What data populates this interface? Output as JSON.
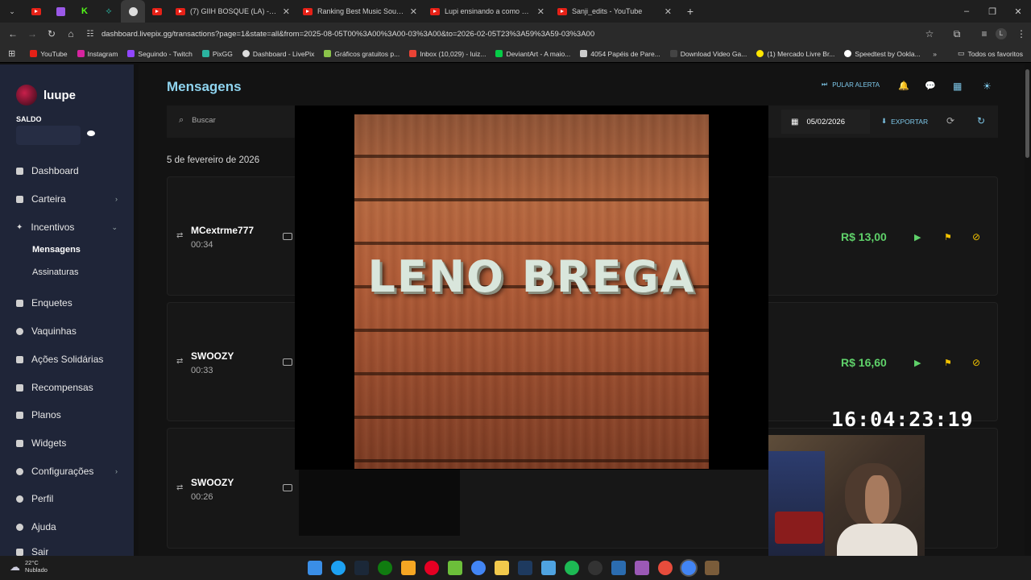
{
  "browser": {
    "tabs": [
      {
        "label": "(7) GIIH BOSQUE (LA) - YouTub",
        "active": false
      },
      {
        "label": "Ranking Best Music Sounds 😊",
        "active": false
      },
      {
        "label": "Lupi ensinando a como ganhar",
        "active": false
      },
      {
        "label": "Sanji_edits - YouTube",
        "active": false
      }
    ],
    "url": "dashboard.livepix.gg/transactions?page=1&state=all&from=2025-08-05T00%3A00%3A00-03%3A00&to=2026-02-05T23%3A59%3A59-03%3A00",
    "bookmarks": [
      {
        "label": "YouTube",
        "color": "#e62117"
      },
      {
        "label": "Instagram",
        "color": "#d6249f"
      },
      {
        "label": "Seguindo - Twitch",
        "color": "#9146ff"
      },
      {
        "label": "PixGG",
        "color": "#2bb3a0"
      },
      {
        "label": "Dashboard - LivePix",
        "color": "#dddddd"
      },
      {
        "label": "Gráficos gratuitos p...",
        "color": "#8bc34a"
      },
      {
        "label": "Inbox (10,029) - luiz...",
        "color": "#ea4335"
      },
      {
        "label": "DeviantArt - A maio...",
        "color": "#05cc47"
      },
      {
        "label": "4054 Papéis de Pare...",
        "color": "#cccccc"
      },
      {
        "label": "Download Video Ga...",
        "color": "#444444"
      },
      {
        "label": "(1) Mercado Livre Br...",
        "color": "#ffe600"
      },
      {
        "label": "Speedtest by Ookla...",
        "color": "#ffffff"
      }
    ],
    "all_favorites": "Todos os favoritos"
  },
  "sidebar": {
    "brand": "luupe",
    "saldo_label": "SALDO",
    "items": [
      {
        "label": "Dashboard",
        "top": 0
      },
      {
        "label": "Carteira",
        "has_chevron": true
      },
      {
        "label": "Incentivos",
        "expanded": true
      },
      {
        "label": "Enquetes"
      },
      {
        "label": "Vaquinhas"
      },
      {
        "label": "Ações Solidárias"
      },
      {
        "label": "Recompensas"
      },
      {
        "label": "Planos"
      },
      {
        "label": "Widgets"
      },
      {
        "label": "Configurações",
        "has_chevron": true
      },
      {
        "label": "Perfil"
      },
      {
        "label": "Ajuda"
      },
      {
        "label": "Sair"
      }
    ],
    "sub_items": [
      "Mensagens",
      "Assinaturas"
    ]
  },
  "main": {
    "title": "Mensagens",
    "skip_alert": "PULAR ALERTA",
    "search_placeholder": "Buscar",
    "date_value": "05/02/2026",
    "export_label": "EXPORTAR",
    "date_heading": "5 de fevereiro de 2026",
    "messages": [
      {
        "name": "MCextrme777",
        "time": "00:34",
        "amount": "R$ 13,00"
      },
      {
        "name": "SWOOZY",
        "time": "00:33",
        "amount": "R$ 16,60"
      },
      {
        "name": "SWOOZY",
        "time": "00:26",
        "amount": ""
      }
    ]
  },
  "overlay": {
    "album_text": "LENO BREGA",
    "clock": "16:04:23:19"
  },
  "taskbar": {
    "temperature": "22°C",
    "weather": "Nublado"
  }
}
